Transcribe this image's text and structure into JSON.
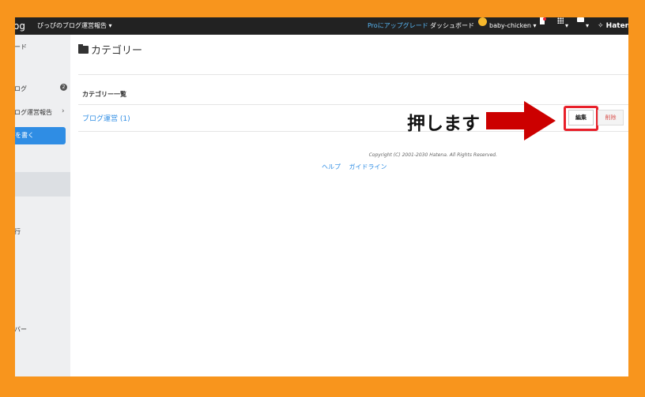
{
  "topbar": {
    "logo": "og",
    "blog_name": "ぴっぴのブログ運営報告 ▾",
    "pro": "Proにアップグレード",
    "dashboard": "ダッシュボード",
    "user": "baby-chicken ▾",
    "caret": "▾",
    "hatena": "✧ Hatena"
  },
  "sidebar": {
    "items": [
      {
        "label": "ード"
      },
      {
        "label": "ログ"
      },
      {
        "label": "ログ運営報告"
      },
      {
        "label": "を書く"
      },
      {
        "label": "行"
      },
      {
        "label": "バー"
      }
    ],
    "badge": "2",
    "chevron": "›"
  },
  "main": {
    "title": "カテゴリー",
    "panel_heading": "カテゴリー一覧",
    "category": "ブログ運営 (1)",
    "edit_label": "編集",
    "delete_label": "削除",
    "annotation": "押します"
  },
  "footer": {
    "copyright": "Copyright (C) 2001-2030 Hatena. All Rights Reserved.",
    "links": [
      "ヘルプ",
      "ガイドライン"
    ]
  },
  "colors": {
    "frame_bg": "#f8951d",
    "topbar": "#222222",
    "link": "#2f8de4",
    "highlight": "#e8202a",
    "arrow": "#cc0000"
  }
}
